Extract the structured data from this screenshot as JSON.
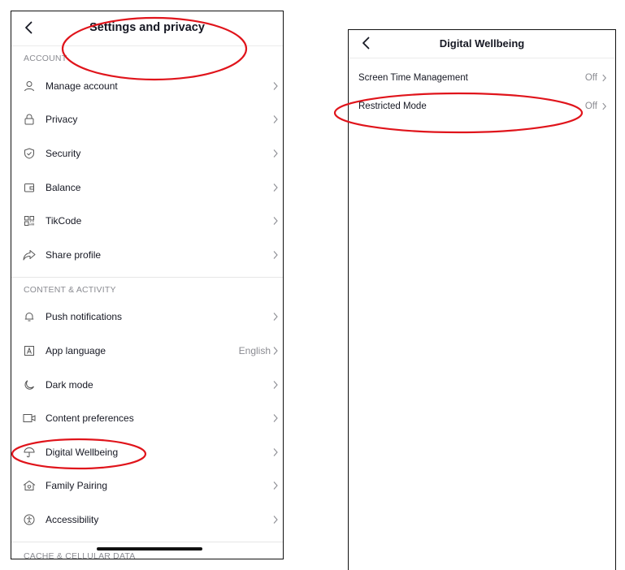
{
  "left_screen": {
    "title": "Settings and privacy",
    "sections": [
      {
        "heading": "ACCOUNT",
        "items": [
          {
            "label": "Manage account",
            "icon": "person-icon",
            "value": ""
          },
          {
            "label": "Privacy",
            "icon": "lock-icon",
            "value": ""
          },
          {
            "label": "Security",
            "icon": "shield-icon",
            "value": ""
          },
          {
            "label": "Balance",
            "icon": "wallet-icon",
            "value": ""
          },
          {
            "label": "TikCode",
            "icon": "qr-code-icon",
            "value": ""
          },
          {
            "label": "Share profile",
            "icon": "share-icon",
            "value": ""
          }
        ]
      },
      {
        "heading": "CONTENT & ACTIVITY",
        "items": [
          {
            "label": "Push notifications",
            "icon": "bell-icon",
            "value": ""
          },
          {
            "label": "App language",
            "icon": "language-icon",
            "value": "English"
          },
          {
            "label": "Dark mode",
            "icon": "moon-icon",
            "value": ""
          },
          {
            "label": "Content preferences",
            "icon": "video-camera-icon",
            "value": ""
          },
          {
            "label": "Digital Wellbeing",
            "icon": "umbrella-icon",
            "value": ""
          },
          {
            "label": "Family Pairing",
            "icon": "house-heart-icon",
            "value": ""
          },
          {
            "label": "Accessibility",
            "icon": "accessibility-icon",
            "value": ""
          }
        ]
      },
      {
        "heading": "CACHE & CELLULAR DATA",
        "items": []
      }
    ]
  },
  "right_screen": {
    "title": "Digital Wellbeing",
    "items": [
      {
        "label": "Screen Time Management",
        "value": "Off"
      },
      {
        "label": "Restricted Mode",
        "value": "Off"
      }
    ]
  },
  "colors": {
    "annotation": "#e0141b",
    "text_primary": "#161823",
    "text_secondary": "#8a8b91",
    "divider": "#e6e6e6"
  }
}
